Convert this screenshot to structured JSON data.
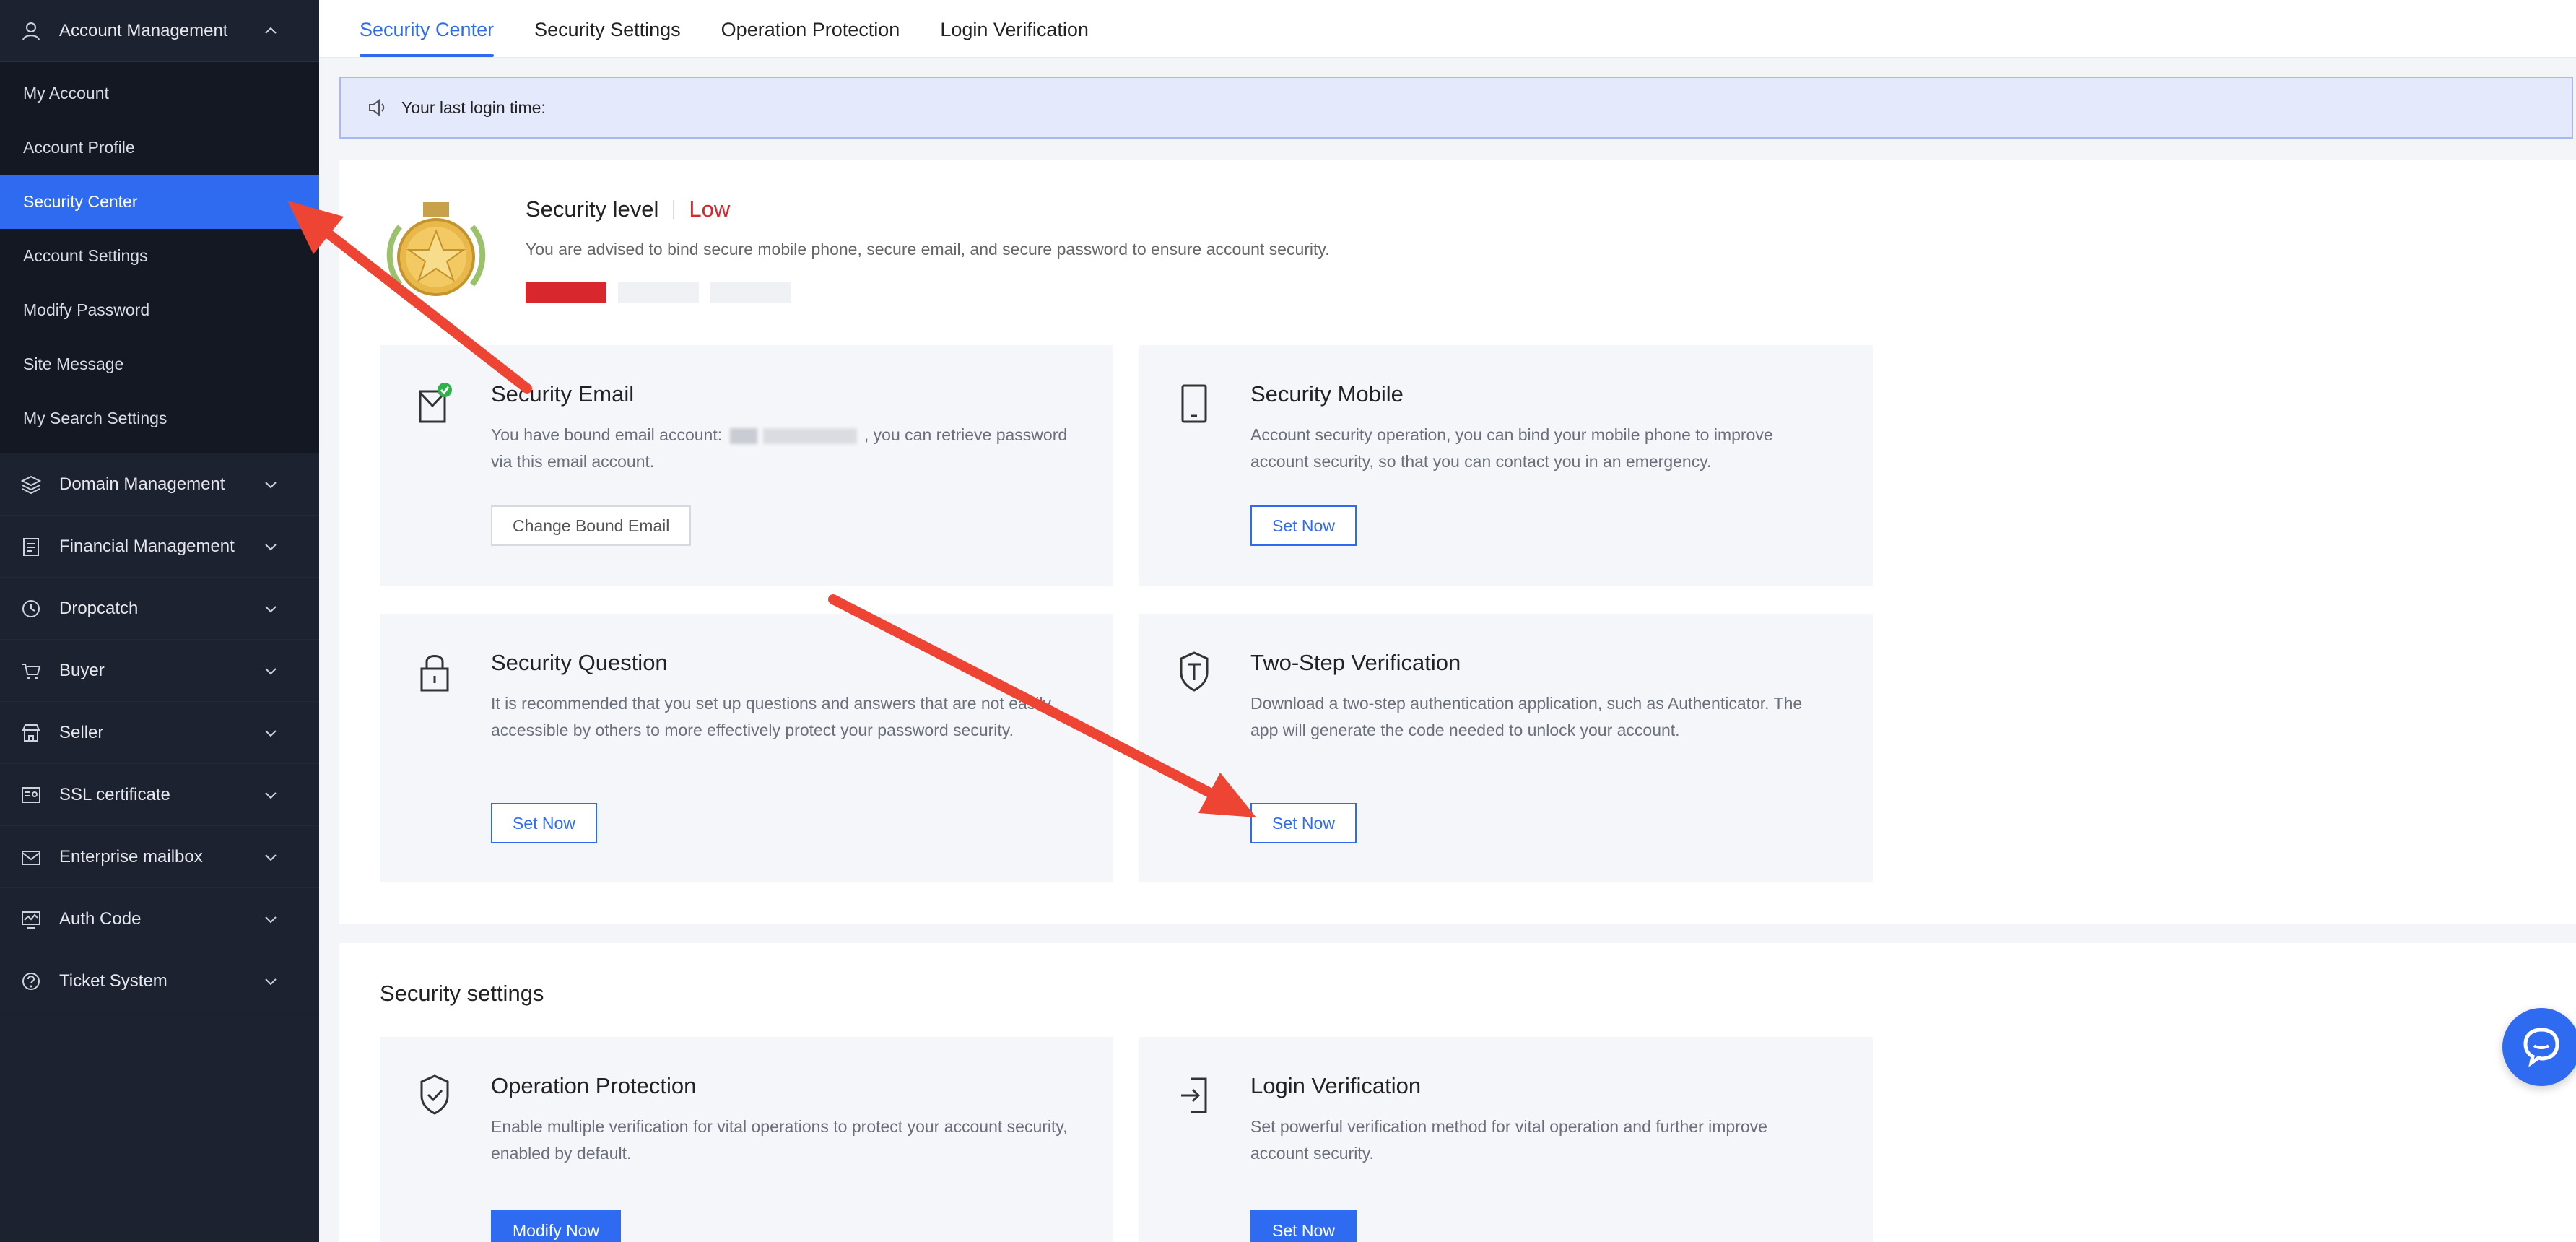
{
  "sidebar": {
    "account": {
      "label": "Account Management",
      "items": [
        "My Account",
        "Account Profile",
        "Security Center",
        "Account Settings",
        "Modify Password",
        "Site Message",
        "My Search Settings"
      ]
    },
    "groups": [
      {
        "label": "Domain Management",
        "icon": "layers-icon"
      },
      {
        "label": "Financial Management",
        "icon": "ledger-icon"
      },
      {
        "label": "Dropcatch",
        "icon": "clock-icon"
      },
      {
        "label": "Buyer",
        "icon": "cart-icon"
      },
      {
        "label": "Seller",
        "icon": "store-icon"
      },
      {
        "label": "SSL certificate",
        "icon": "certificate-icon"
      },
      {
        "label": "Enterprise mailbox",
        "icon": "mailbox-icon"
      },
      {
        "label": "Auth Code",
        "icon": "monitor-icon"
      },
      {
        "label": "Ticket System",
        "icon": "question-icon"
      }
    ]
  },
  "tabs": [
    "Security Center",
    "Security Settings",
    "Operation Protection",
    "Login Verification"
  ],
  "notice": "Your last login time:",
  "security": {
    "title": "Security level",
    "level": "Low",
    "desc": "You are advised to bind secure mobile phone, secure email, and secure password to ensure account security.",
    "bars_filled": 1,
    "bars_total": 3
  },
  "cards": {
    "email": {
      "title": "Security Email",
      "desc_pre": "You have bound email account:",
      "desc_post": ", you can retrieve password via this email account.",
      "button": "Change Bound Email"
    },
    "mobile": {
      "title": "Security Mobile",
      "desc": "Account security operation, you can bind your mobile phone to improve account security, so that you can contact you in an emergency.",
      "button": "Set Now"
    },
    "question": {
      "title": "Security Question",
      "desc": "It is recommended that you set up questions and answers that are not easily accessible by others to more effectively protect your password security.",
      "button": "Set Now"
    },
    "twostep": {
      "title": "Two-Step Verification",
      "desc": "Download a two-step authentication application, such as Authenticator. The app will generate the code needed to unlock your account.",
      "button": "Set Now"
    }
  },
  "settings": {
    "title": "Security settings",
    "operation": {
      "title": "Operation Protection",
      "desc": "Enable multiple verification for vital operations to protect your account security, enabled by default.",
      "button": "Modify Now"
    },
    "login": {
      "title": "Login Verification",
      "desc": "Set powerful verification method for vital operation and further improve account security.",
      "button": "Set Now"
    }
  },
  "colors": {
    "accent": "#2f6bf1",
    "danger": "#d9272e",
    "sidebar_bg": "#1d2230",
    "annotation_arrow": "#ee4433"
  }
}
